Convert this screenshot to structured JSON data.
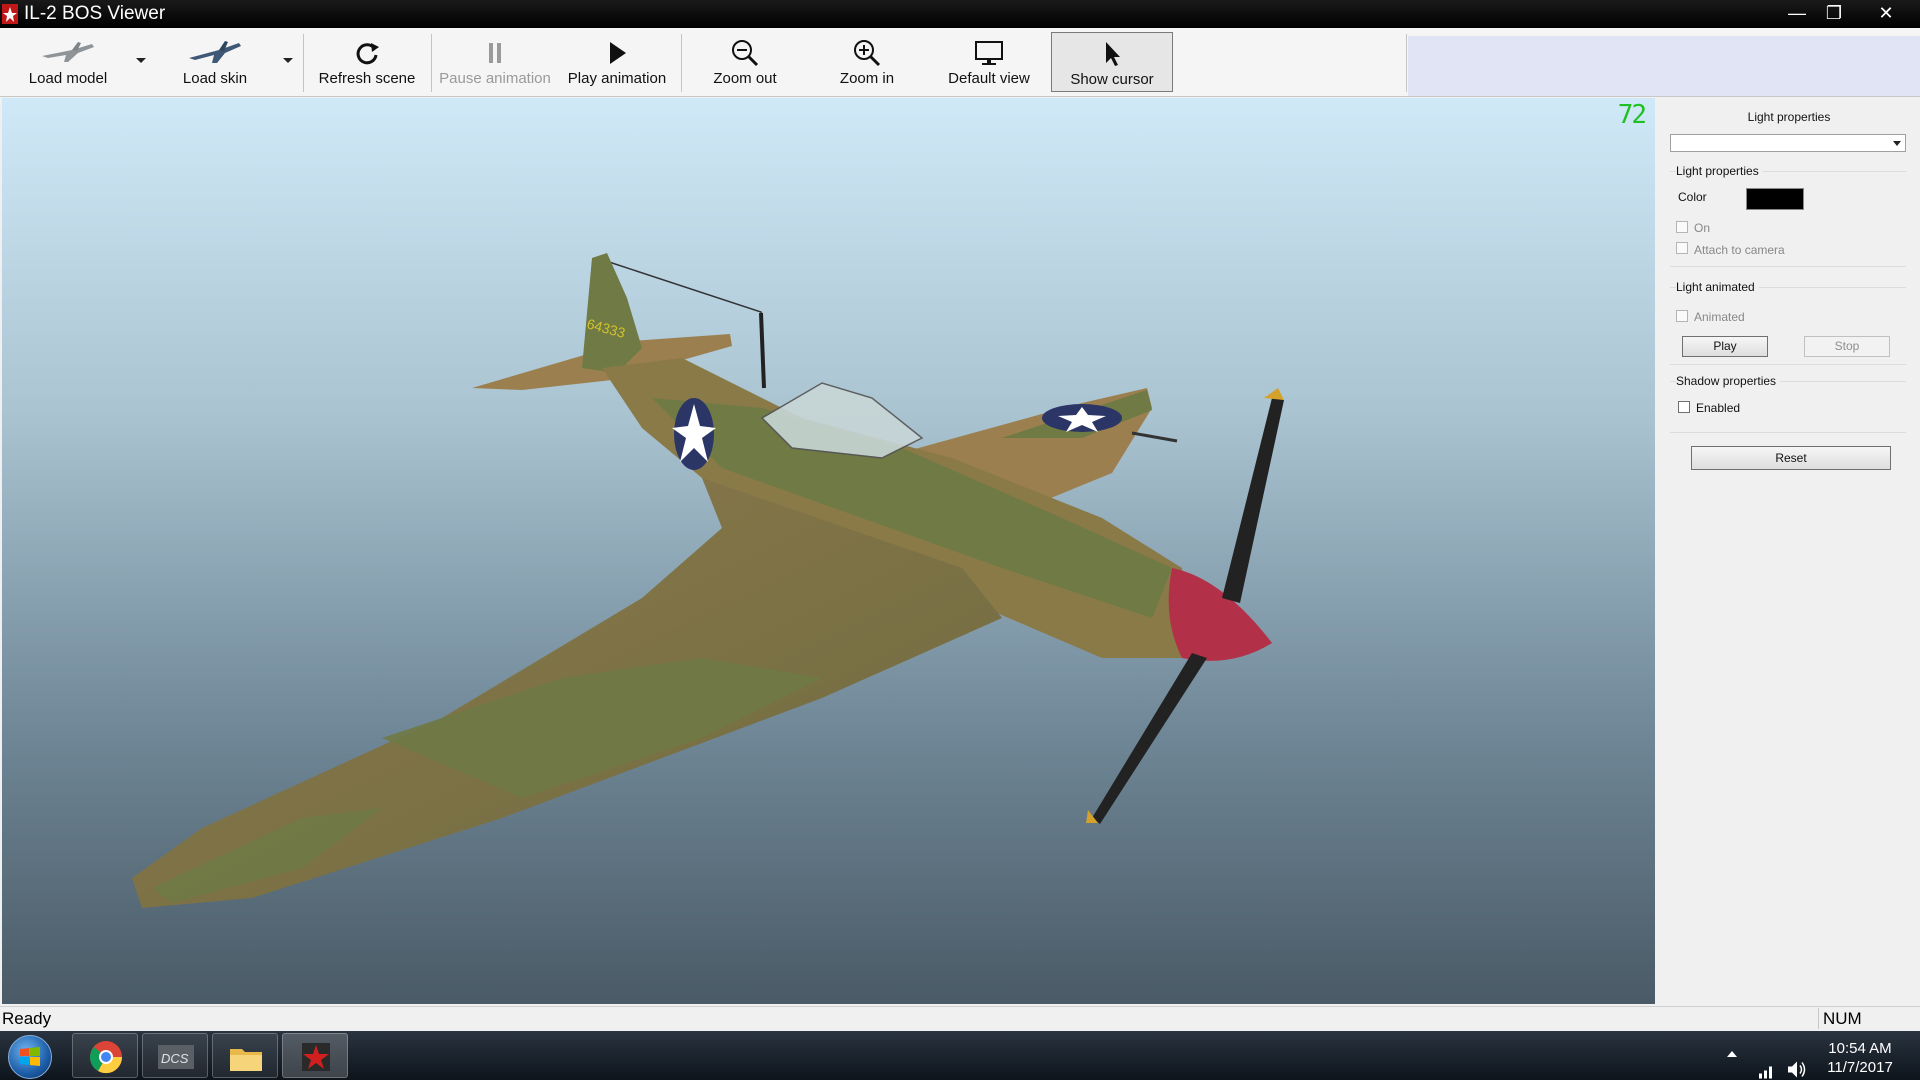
{
  "window": {
    "title": "IL-2 BOS Viewer",
    "minimize_glyph": "—",
    "maximize_glyph": "❐",
    "close_glyph": "✕"
  },
  "toolbar": {
    "load_model": "Load model",
    "load_skin": "Load skin",
    "refresh_scene": "Refresh scene",
    "pause_animation": "Pause animation",
    "play_animation": "Play animation",
    "zoom_out": "Zoom out",
    "zoom_in": "Zoom in",
    "default_view": "Default view",
    "show_cursor": "Show cursor"
  },
  "viewport": {
    "fps": "72",
    "aircraft": {
      "tail_number": "64333",
      "colors": {
        "olive": "#6f7a45",
        "tan": "#9b7f4f",
        "spinner": "#b23148",
        "roundel_blue": "#2b3566"
      }
    }
  },
  "panel": {
    "title": "Light properties",
    "selected_light": "",
    "light_group": {
      "title": "Light properties",
      "color_label": "Color",
      "color_value": "#000000",
      "on_label": "On",
      "attach_label": "Attach to camera"
    },
    "animated_group": {
      "title": "Light animated",
      "animated_label": "Animated",
      "play": "Play",
      "stop": "Stop"
    },
    "shadow_group": {
      "title": "Shadow properties",
      "enabled_label": "Enabled"
    },
    "reset": "Reset"
  },
  "status": {
    "text": "Ready",
    "num": "NUM"
  },
  "taskbar": {
    "apps": [
      "windows-start",
      "chrome",
      "dcs",
      "file-explorer",
      "il2-viewer"
    ],
    "time": "10:54 AM",
    "date": "11/7/2017"
  }
}
